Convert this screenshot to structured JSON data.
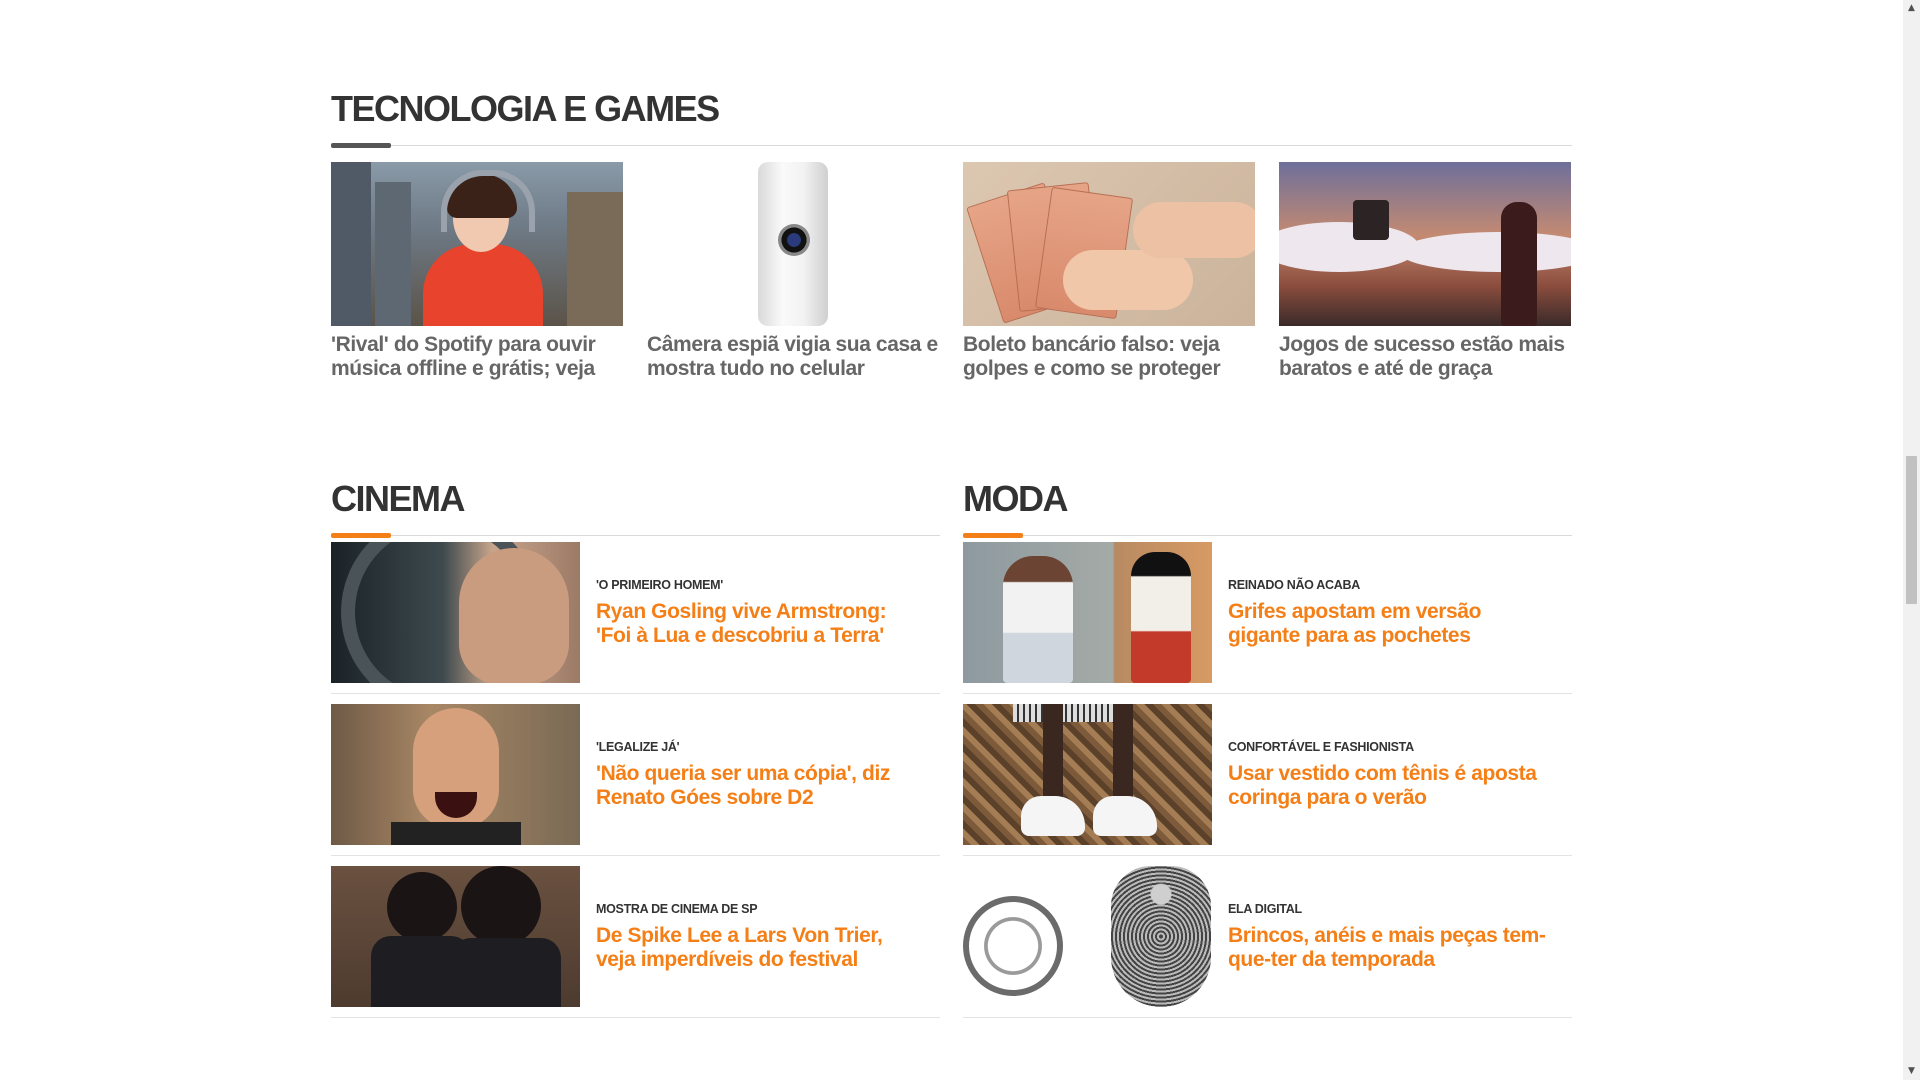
{
  "tecnologia": {
    "title": "TECNOLOGIA E GAMES",
    "cards": [
      {
        "headline": "'Rival' do Spotify para ouvir música offline e grátis; veja"
      },
      {
        "headline": "Câmera espiã vigia sua casa e mostra tudo no celular"
      },
      {
        "headline": "Boleto bancário falso: veja golpes e como se proteger"
      },
      {
        "headline": "Jogos de sucesso estão mais baratos e até de graça"
      }
    ]
  },
  "cinema": {
    "title": "CINEMA",
    "items": [
      {
        "kicker": "'O PRIMEIRO HOMEM'",
        "headline": "Ryan Gosling vive Armstrong: 'Foi à Lua e descobriu a Terra'"
      },
      {
        "kicker": "'LEGALIZE JÁ'",
        "headline": "'Não queria ser uma cópia', diz Renato Góes sobre D2"
      },
      {
        "kicker": "MOSTRA DE CINEMA DE SP",
        "headline": "De Spike Lee a Lars Von Trier, veja imperdíveis do festival"
      }
    ]
  },
  "moda": {
    "title": "MODA",
    "items": [
      {
        "kicker": "REINADO NÃO ACABA",
        "headline": "Grifes apostam em versão gigante para as pochetes"
      },
      {
        "kicker": "CONFORTÁVEL E FASHIONISTA",
        "headline": "Usar vestido com tênis é aposta coringa para o verão"
      },
      {
        "kicker": "ELA DIGITAL",
        "headline": "Brincos, anéis e mais peças tem-que-ter da temporada"
      }
    ]
  },
  "colors": {
    "accent": "#f57f17",
    "title": "#333333",
    "headline_gray": "#666666"
  },
  "scrollbar": {
    "up_arrow": "▲",
    "down_arrow": "▼"
  }
}
